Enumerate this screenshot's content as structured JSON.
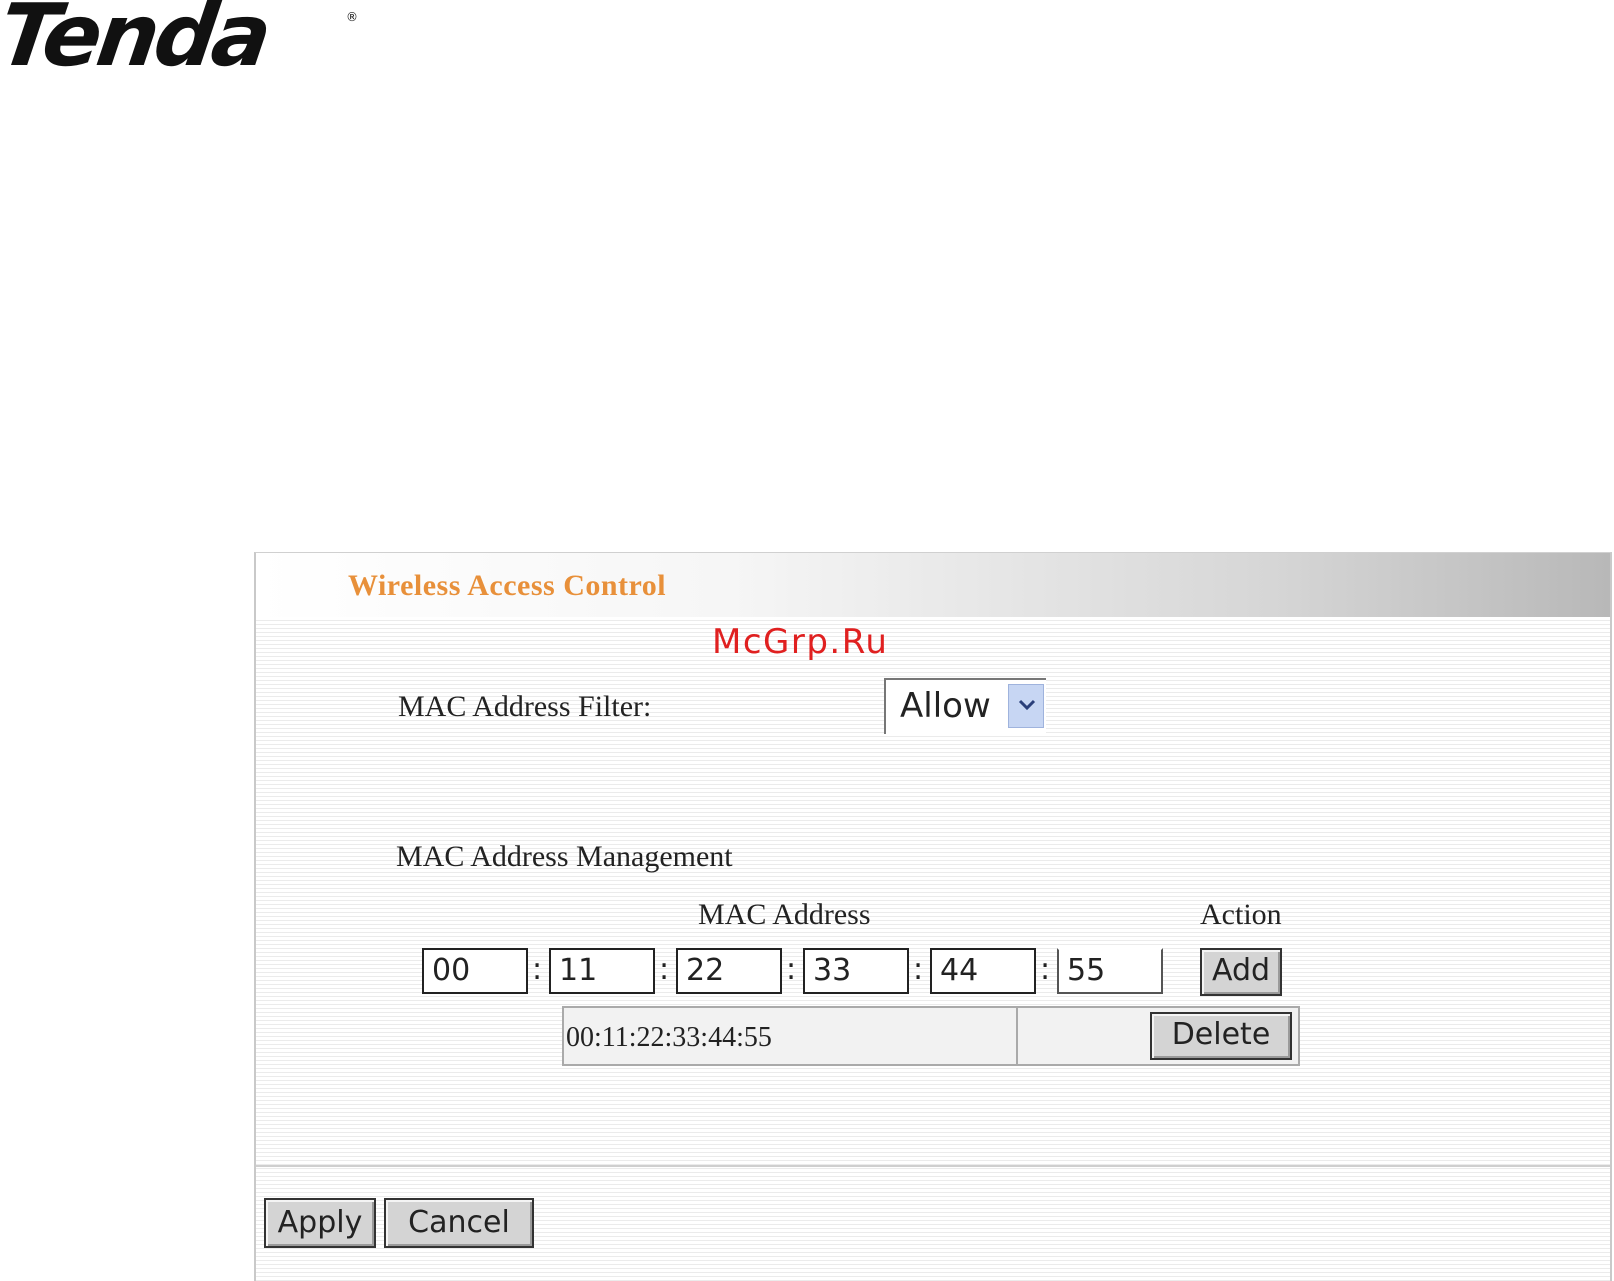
{
  "logo": {
    "text": "Tenda",
    "registered": "®"
  },
  "watermark": "McGrp.Ru",
  "panel": {
    "title": "Wireless Access Control",
    "filter_label": "MAC Address Filter:",
    "filter_selected": "Allow",
    "management_label": "MAC Address Management",
    "col_mac": "MAC Address",
    "col_action": "Action",
    "mac_fields": [
      "00",
      "11",
      "22",
      "33",
      "44",
      "55"
    ],
    "separator": ":",
    "add_label": "Add",
    "entries": [
      {
        "mac": "00:11:22:33:44:55",
        "delete_label": "Delete"
      }
    ],
    "apply_label": "Apply",
    "cancel_label": "Cancel"
  },
  "colors": {
    "title": "#e8903a",
    "watermark": "#e02020",
    "dropdown_arrow_bg": "#c7d6f3",
    "button_bg": "#d4d4d4"
  },
  "icons": {
    "dropdown": "chevron-down-icon"
  }
}
